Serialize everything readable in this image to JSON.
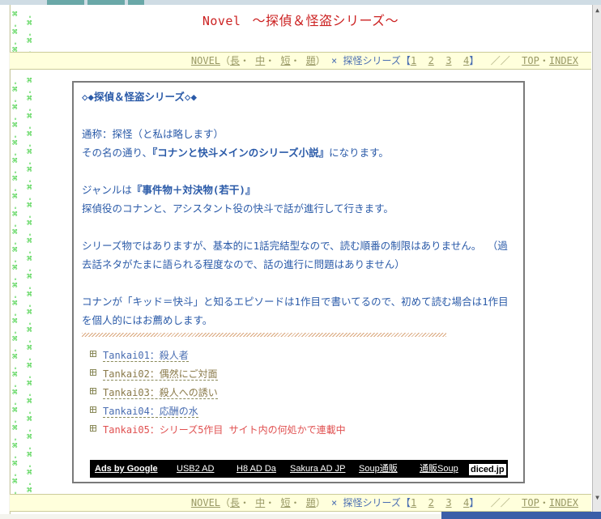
{
  "header": {
    "novel_label": "Novel",
    "title": "～探偵＆怪盗シリーズ～"
  },
  "nav": {
    "novel": "NOVEL",
    "paren_open": "（",
    "long": "長",
    "mid": "中",
    "short": "短",
    "topic": "題",
    "paren_close": "）",
    "separator": "×",
    "series": "探怪シリーズ",
    "bracket_open": "【",
    "pages": [
      "1",
      "2",
      "3",
      "4"
    ],
    "bracket_close": "】",
    "slashes": "／／",
    "top": "TOP",
    "index": "INDEX"
  },
  "content": {
    "heading": "◇◆探偵＆怪盗シリーズ◇◆",
    "line1": "通称：探怪（と私は略します）",
    "line2_pre": "その名の通り、",
    "line2_bold": "『コナンと快斗メインのシリーズ小説』",
    "line2_post": "になります。",
    "line3_pre": "ジャンルは",
    "line3_bold": "『事件物＋対決物(若干)』",
    "line4": "探偵役のコナンと、アシスタント役の快斗で話が進行して行きます。",
    "line5": "シリーズ物ではありますが、基本的に1話完結型なので、読む順番の制限はありません。 （過去話ネタがたまに語られる程度なので、話の進行に問題はありません）",
    "line6": "コナンが「キッド＝快斗」と知るエピソードは1作目で書いてるので、初めて読む場合は1作目を個人的にはお薦めします。"
  },
  "stories": [
    {
      "label": "Tankai01：殺人者"
    },
    {
      "label": "Tankai02：偶然にご対面"
    },
    {
      "label": "Tankai03：殺人への誘い"
    },
    {
      "label": "Tankai04：応酬の水"
    },
    {
      "label": "Tankai05：シリーズ5作目 サイト内の何処かで連載中"
    }
  ],
  "ads": {
    "ads_by_google": "Ads by Google",
    "links": [
      "USB2 AD",
      "H8 AD Da",
      "Sakura AD JP",
      "Soup通販",
      "通販Soup"
    ],
    "diced": "diced.jp"
  },
  "colors": {
    "title_red": "#cc2222",
    "text_blue": "#2a5aa8",
    "nav_olive": "#999966",
    "nav_bg": "#ffffdc",
    "deco_green": "#33cc33",
    "red_item": "#e05050"
  }
}
